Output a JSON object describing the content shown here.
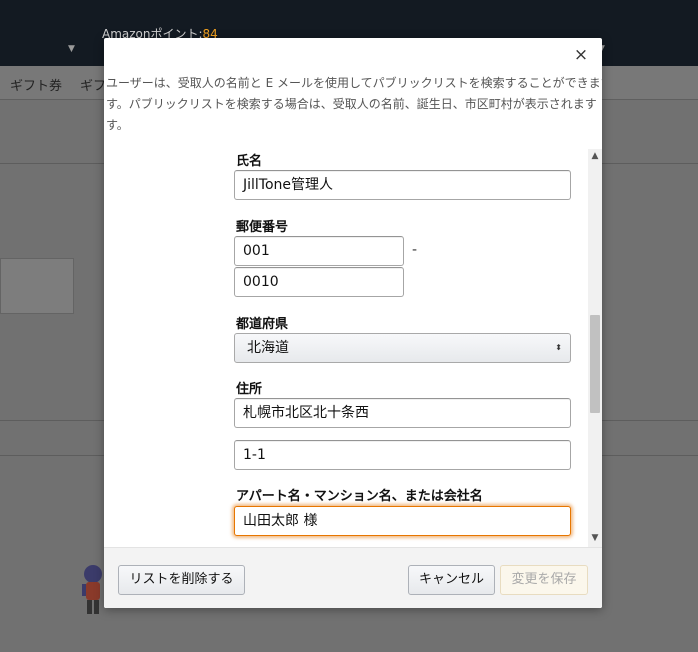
{
  "background": {
    "points_label": "Amazonポイント:",
    "points_value": "84",
    "nav": [
      "ギフト券",
      "ギフ"
    ]
  },
  "modal": {
    "close_symbol": "×",
    "description": [
      "ユーザーは、受取人の名前と E メールを使用してパブリックリストを検索することができます。",
      "す。パブリックリストを検索する場合は、受取人の名前、誕生日、市区町村が表示されます",
      "す。"
    ],
    "fields": {
      "name_label": "氏名",
      "name_value": "JillTone管理人",
      "postal_label": "郵便番号",
      "postal_part1": "001",
      "postal_separator": "-",
      "postal_part2": "0010",
      "prefecture_label": "都道府県",
      "prefecture_value": "北海道",
      "address_label": "住所",
      "address_line1": "札幌市北区北十条西",
      "address_line2": "1-1",
      "building_label": "アパート名・マンション名、または会社名",
      "building_value": "山田太郎 様"
    },
    "buttons": {
      "delete": "リストを削除する",
      "cancel": "キャンセル",
      "save": "変更を保存"
    },
    "icons": {
      "close": "close-icon",
      "select_arrow": "select-arrow-icon",
      "scroll_up": "scroll-up-icon",
      "scroll_down": "scroll-down-icon"
    }
  }
}
